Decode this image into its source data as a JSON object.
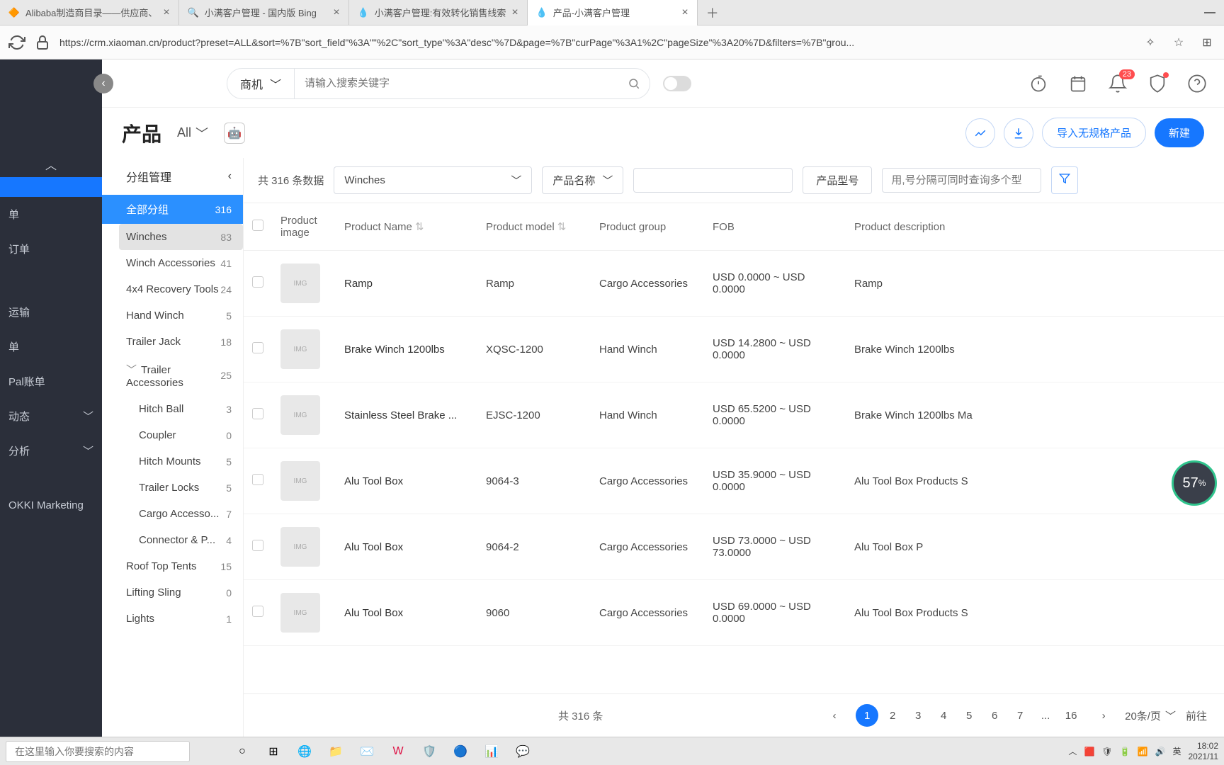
{
  "browser": {
    "tabs": [
      {
        "title": "Alibaba制造商目录——供应商、",
        "icon": "🔶"
      },
      {
        "title": "小满客户管理 - 国内版 Bing",
        "icon": "🔍"
      },
      {
        "title": "小满客户管理:有效转化销售线索",
        "icon": "💧"
      },
      {
        "title": "产品-小满客户管理",
        "icon": "💧",
        "active": true
      }
    ],
    "url": "https://crm.xiaoman.cn/product?preset=ALL&sort=%7B\"sort_field\"%3A\"\"%2C\"sort_type\"%3A\"desc\"%7D&page=%7B\"curPage\"%3A1%2C\"pageSize\"%3A20%7D&filters=%7B\"grou..."
  },
  "header": {
    "searchCategory": "商机",
    "searchPlaceholder": "请输入搜索关键字",
    "notificationCount": "23"
  },
  "darkSidebar": {
    "items": [
      {
        "label": "",
        "active": true
      },
      {
        "label": "单"
      },
      {
        "label": "订单"
      },
      {
        "label": "运输"
      },
      {
        "label": "单"
      },
      {
        "label": "Pal账单"
      },
      {
        "label": "动态",
        "expandable": true
      },
      {
        "label": "分析",
        "expandable": true
      },
      {
        "label": "OKKI Marketing"
      }
    ]
  },
  "page": {
    "title": "产品",
    "filterLabel": "All",
    "importBtn": "导入无规格产品",
    "createBtn": "新建"
  },
  "groups": {
    "headerLabel": "分组管理",
    "items": [
      {
        "name": "全部分组",
        "count": "316",
        "selected": true
      },
      {
        "name": "Winches",
        "count": "83",
        "active": true
      },
      {
        "name": "Winch Accessories",
        "count": "41"
      },
      {
        "name": "4x4 Recovery Tools",
        "count": "24"
      },
      {
        "name": "Hand Winch",
        "count": "5"
      },
      {
        "name": "Trailer Jack",
        "count": "18"
      },
      {
        "name": "Trailer Accessories",
        "count": "25",
        "expanded": true
      },
      {
        "name": "Roof Top Tents",
        "count": "15"
      },
      {
        "name": "Lifting Sling",
        "count": "0"
      },
      {
        "name": "Lights",
        "count": "1"
      }
    ],
    "subItems": [
      {
        "name": "Hitch Ball",
        "count": "3"
      },
      {
        "name": "Coupler",
        "count": "0"
      },
      {
        "name": "Hitch Mounts",
        "count": "5"
      },
      {
        "name": "Trailer Locks",
        "count": "5"
      },
      {
        "name": "Cargo Accesso...",
        "count": "7"
      },
      {
        "name": "Connector & P...",
        "count": "4"
      }
    ]
  },
  "filters": {
    "countText": "共 316 条数据",
    "groupSelect": "Winches",
    "nameSort": "产品名称",
    "modelBtn": "产品型号",
    "modelPlaceholder": "用,号分隔可同时查询多个型"
  },
  "table": {
    "headers": {
      "image": "Product image",
      "name": "Product Name",
      "model": "Product model",
      "group": "Product group",
      "fob": "FOB",
      "desc": "Product description"
    },
    "rows": [
      {
        "name": "Ramp",
        "model": "Ramp",
        "group": "Cargo Accessories",
        "fob": "USD 0.0000 ~ USD 0.0000",
        "desc": "Ramp"
      },
      {
        "name": "Brake Winch 1200lbs",
        "model": "XQSC-1200",
        "group": "Hand Winch",
        "fob": "USD 14.2800 ~ USD 0.0000",
        "desc": "Brake Winch 1200lbs"
      },
      {
        "name": "Stainless Steel Brake ...",
        "model": "EJSC-1200",
        "group": "Hand Winch",
        "fob": "USD 65.5200 ~ USD 0.0000",
        "desc": "Brake Winch 1200lbs Ma"
      },
      {
        "name": "Alu Tool Box",
        "model": "9064-3",
        "group": "Cargo Accessories",
        "fob": "USD 35.9000 ~ USD 0.0000",
        "desc": "Alu Tool Box Products S"
      },
      {
        "name": "Alu Tool Box",
        "model": "9064-2",
        "group": "Cargo Accessories",
        "fob": "USD 73.0000 ~ USD 73.0000",
        "desc": "Alu Tool Box P"
      },
      {
        "name": "Alu Tool Box",
        "model": "9060",
        "group": "Cargo Accessories",
        "fob": "USD 69.0000 ~ USD 0.0000",
        "desc": "Alu Tool Box Products S"
      }
    ]
  },
  "pagination": {
    "total": "共 316 条",
    "pages": [
      "1",
      "2",
      "3",
      "4",
      "5",
      "6",
      "7",
      "...",
      "16"
    ],
    "activePage": "1",
    "pageSize": "20条/页",
    "goto": "前往"
  },
  "meter": {
    "value": "57",
    "unit": "%"
  },
  "taskbar": {
    "searchPlaceholder": "在这里输入你要搜索的内容",
    "time": "18:02",
    "date": "2021/11",
    "lang": "英"
  }
}
